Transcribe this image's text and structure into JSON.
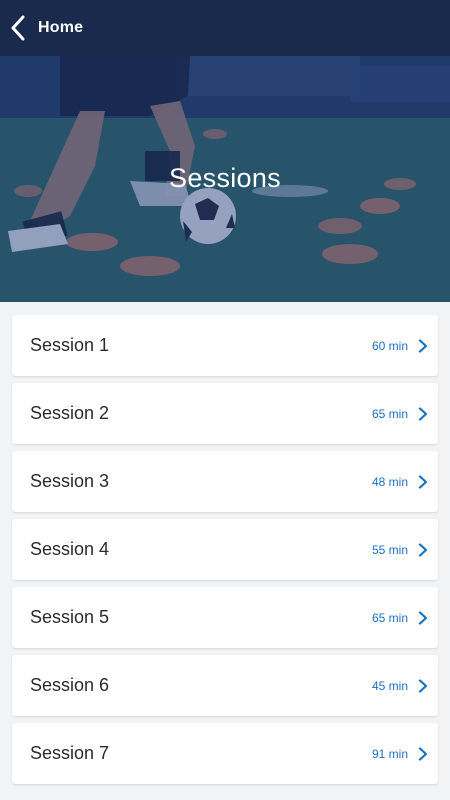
{
  "header": {
    "back_label": "Home",
    "title": "Sessions"
  },
  "colors": {
    "header_bg": "#1a2a4d",
    "accent": "#1c6fc2",
    "background": "#f2f3f5"
  },
  "sessions": [
    {
      "name": "Session 1",
      "duration": "60 min"
    },
    {
      "name": "Session 2",
      "duration": "65 min"
    },
    {
      "name": "Session 3",
      "duration": "48 min"
    },
    {
      "name": "Session 4",
      "duration": "55 min"
    },
    {
      "name": "Session 5",
      "duration": "65 min"
    },
    {
      "name": "Session 6",
      "duration": "45 min"
    },
    {
      "name": "Session 7",
      "duration": "91 min"
    }
  ],
  "icons": {
    "back": "chevron-left-icon",
    "row": "chevron-right-icon"
  }
}
